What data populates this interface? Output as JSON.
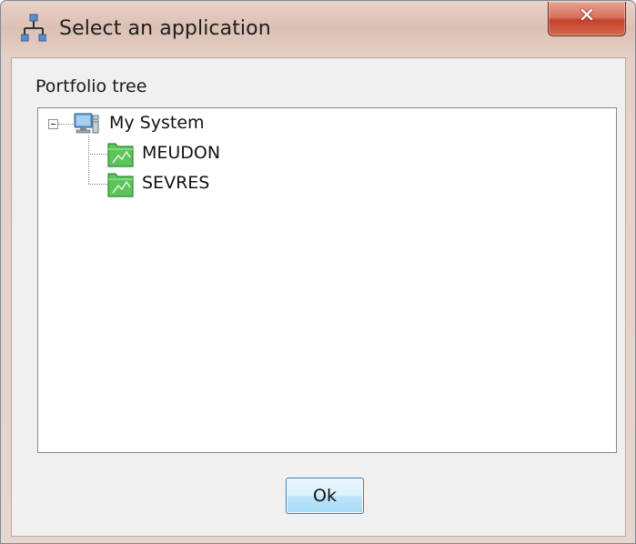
{
  "window": {
    "title": "Select an application",
    "close_symbol": "✕"
  },
  "group": {
    "label": "Portfolio tree"
  },
  "tree": {
    "root": {
      "label": "My System",
      "icon": "computer-icon",
      "expanded": true
    },
    "children": [
      {
        "label": "MEUDON",
        "icon": "application-icon"
      },
      {
        "label": "SEVRES",
        "icon": "application-icon"
      }
    ]
  },
  "buttons": {
    "ok_label": "Ok"
  },
  "colors": {
    "folder_green": "#4bb84b",
    "accent_blue": "#3c7fb1",
    "close_red": "#c4412a"
  }
}
